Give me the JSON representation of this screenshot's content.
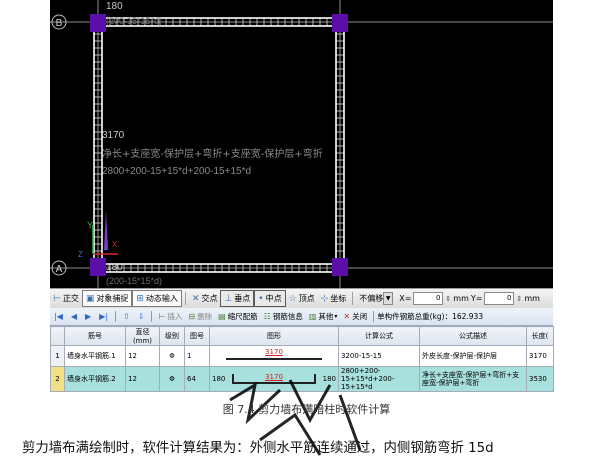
{
  "cad": {
    "axis_b": "B",
    "axis_a": "A",
    "dim_top": "180",
    "dim_top_expr": "(200-15*15*d)",
    "dim_left": "3170",
    "formula_desc": "净长+支座宽-保护层+弯折+支座宽-保护层+弯折",
    "formula_expr": "2800+200-15+15*d+200-15+15*d",
    "dim_bottom": "180",
    "dim_bottom_expr": "(200-15*15*d)",
    "ucs_y": "Y",
    "ucs_x": "X",
    "ucs_z": "Z",
    "colors": {
      "background": "#000000",
      "rebar": "#ffffff",
      "column": "#5b0ea8",
      "text": "#c9c9c9",
      "formula": "#8a8a8a",
      "axis": "#8e8e8e"
    }
  },
  "snap_toolbar": {
    "ortho": "正交",
    "object_snap": "对象捕捉",
    "dynamic_input": "动态输入",
    "intersection": "交点",
    "perpendicular": "垂点",
    "midpoint": "中点",
    "vertex": "顶点",
    "coordinate": "坐标",
    "no_offset": "不偏移",
    "x_label": "X=",
    "x_value": "0",
    "mm1": "mm",
    "y_label": "Y=",
    "y_value": "0",
    "mm2": "mm"
  },
  "rebar_toolbar": {
    "insert": "插入",
    "delete": "删除",
    "scale_config": "缩尺配筋",
    "rebar_info": "钢筋信息",
    "other": "其他",
    "close": "关闭",
    "total_weight": "单构件钢筋总重(kg)：162.933"
  },
  "table": {
    "headers": [
      "",
      "筋号",
      "直径(mm)",
      "级别",
      "图号",
      "图形",
      "计算公式",
      "公式描述",
      "长度("
    ],
    "rows": [
      {
        "no": "1",
        "name": "墙身水平钢筋.1",
        "diameter": "12",
        "grade": "Φ",
        "figure_no": "1",
        "shape_mid": "3170",
        "shape_left": "",
        "shape_right": "",
        "formula": "3200-15-15",
        "description": "外皮长度-保护层-保护层",
        "length": "3170"
      },
      {
        "no": "2",
        "name": "墙身水平钢筋.2",
        "diameter": "12",
        "grade": "Φ",
        "figure_no": "64",
        "shape_mid": "3170",
        "shape_left": "180",
        "shape_right": "180",
        "formula": "2800+200-15+15*d+200-15+15*d",
        "description": "净长+支座宽-保护层+弯折+支座宽-保护层+弯折",
        "length": "3530"
      }
    ]
  },
  "caption": "图 7.4  剪力墙布满暗柱时软件计算",
  "body_text": "剪力墙布满绘制时，软件计算结果为：外侧水平筋连续通过，内侧钢筋弯折 15d"
}
